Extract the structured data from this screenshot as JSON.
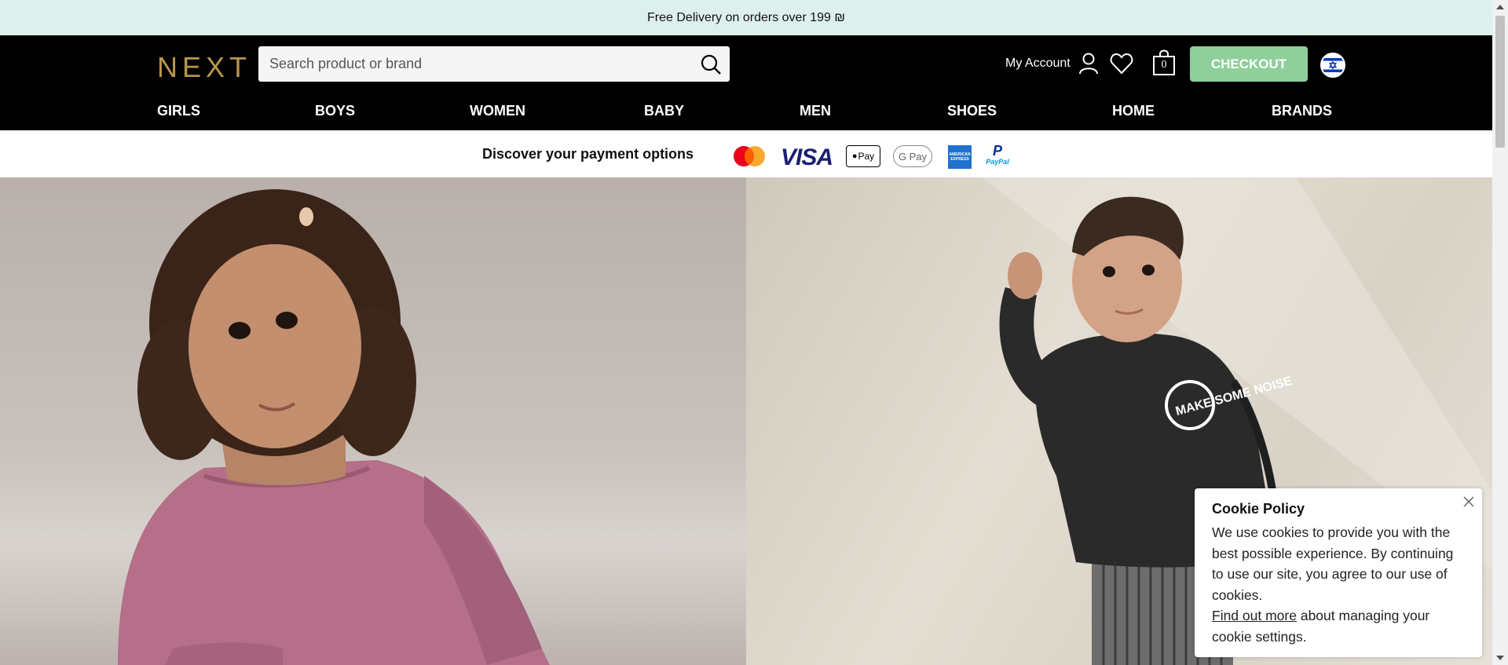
{
  "banner": {
    "text": "Free Delivery on orders over 199 ₪"
  },
  "header": {
    "logo": "NEXT",
    "search_placeholder": "Search product or brand",
    "account_label": "My Account",
    "bag_count": "0",
    "checkout_label": "CHECKOUT"
  },
  "nav": {
    "items": [
      {
        "label": "GIRLS"
      },
      {
        "label": "BOYS"
      },
      {
        "label": "WOMEN"
      },
      {
        "label": "BABY"
      },
      {
        "label": "MEN"
      },
      {
        "label": "SHOES"
      },
      {
        "label": "HOME"
      },
      {
        "label": "BRANDS"
      }
    ]
  },
  "payments": {
    "text": "Discover your payment options",
    "visa": "VISA",
    "applepay": "Pay",
    "googlepay": "G Pay",
    "amex": "AMERICAN EXPRESS",
    "paypal": "PayPal"
  },
  "cookie": {
    "title": "Cookie Policy",
    "body": "We use cookies to provide you with the best possible experience. By continuing to use our site, you agree to our use of cookies.",
    "link": "Find out more",
    "tail": " about managing your cookie settings."
  },
  "hero_left_print": "",
  "hero_right_print": "MAKE SOME NOISE",
  "colors": {
    "accent": "#8fcf9b",
    "logo": "#b8954f",
    "banner_bg": "#ddf0ee"
  }
}
